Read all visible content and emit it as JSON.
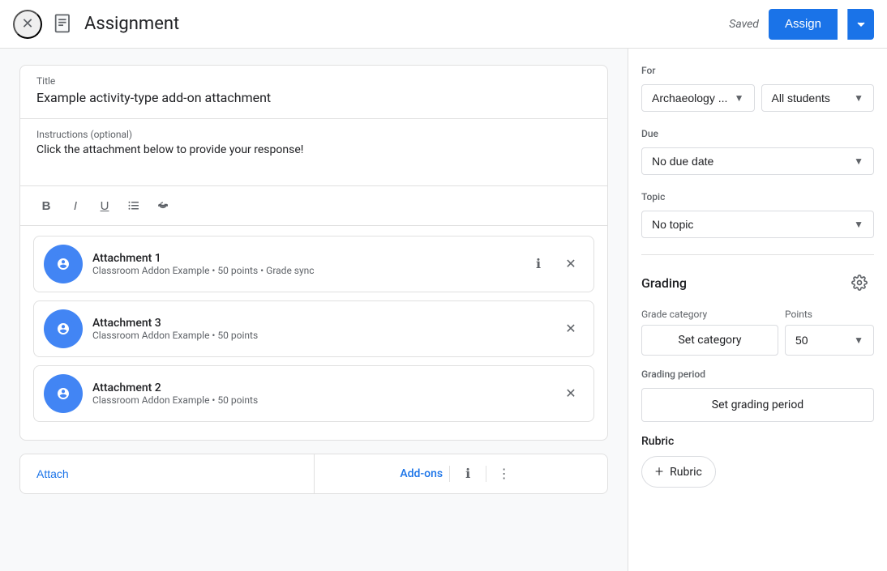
{
  "header": {
    "title": "Assignment",
    "saved_label": "Saved",
    "assign_label": "Assign"
  },
  "form": {
    "title_label": "Title",
    "title_value": "Example activity-type add-on attachment",
    "instructions_label": "Instructions (optional)",
    "instructions_value": "Click the attachment below to provide your response!",
    "toolbar": {
      "bold": "B",
      "italic": "I",
      "underline": "U",
      "list": "≡",
      "strikethrough": "S"
    }
  },
  "attachments": [
    {
      "name": "Attachment 1",
      "meta": "Classroom Addon Example • 50 points • Grade sync"
    },
    {
      "name": "Attachment 3",
      "meta": "Classroom Addon Example • 50 points"
    },
    {
      "name": "Attachment 2",
      "meta": "Classroom Addon Example • 50 points"
    }
  ],
  "bottom_bar": {
    "attach_label": "Attach",
    "addons_label": "Add-ons"
  },
  "right_panel": {
    "for_label": "For",
    "class_value": "Archaeology ...",
    "students_value": "All students",
    "due_label": "Due",
    "due_value": "No due date",
    "topic_label": "Topic",
    "topic_value": "No topic",
    "grading_title": "Grading",
    "grade_category_label": "Grade category",
    "set_category_label": "Set category",
    "points_label": "Points",
    "points_value": "50",
    "grading_period_label": "Grading period",
    "set_grading_period_label": "Set grading period",
    "rubric_label": "Rubric",
    "add_rubric_label": "Rubric"
  }
}
